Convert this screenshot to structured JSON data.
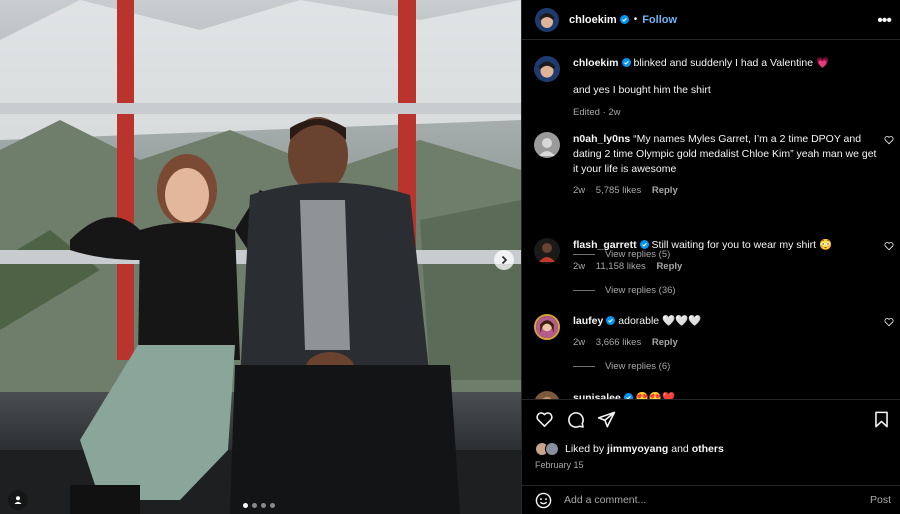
{
  "post": {
    "author": "chloekim",
    "follow_label": "Follow",
    "more_icon": "more-options-icon",
    "caption_line1": "blinked and suddenly I had a Valentine",
    "caption_emoji": "💗",
    "caption_line2": "and yes I bought him the shirt",
    "caption_meta": "Edited · 2w",
    "likes_prefix": "Liked by",
    "likes_user": "jimmyoyang",
    "likes_and": "and",
    "likes_others": "others",
    "date": "February 15"
  },
  "comments": [
    {
      "username": "n0ah_ly0ns",
      "verified": false,
      "text": "“My names Myles Garret, I’m a 2 time DPOY and dating 2 time Olympic gold medalist Chloe Kim” yeah man we get it your life is awesome",
      "time": "2w",
      "likes": "5,785 likes",
      "reply": "Reply",
      "view_replies": "View replies (5)"
    },
    {
      "username": "flash_garrett",
      "verified": true,
      "text": "Still waiting for you to wear my shirt 😳",
      "time": "2w",
      "likes": "11,158 likes",
      "reply": "Reply",
      "view_replies": "View replies (36)"
    },
    {
      "username": "laufey",
      "verified": true,
      "text": "adorable 🤍🤍🤍",
      "time": "2w",
      "likes": "3,666 likes",
      "reply": "Reply",
      "view_replies": "View replies (6)"
    },
    {
      "username": "sunisalee",
      "verified": true,
      "text": "😍😍❤️",
      "time": "",
      "likes": "",
      "reply": "",
      "view_replies": ""
    }
  ],
  "composer": {
    "placeholder": "Add a comment...",
    "post_label": "Post"
  },
  "colors": {
    "accent": "#0095f6",
    "follow": "#6fb3f5",
    "background": "#000000",
    "secondary_text": "#a8a8a8"
  }
}
